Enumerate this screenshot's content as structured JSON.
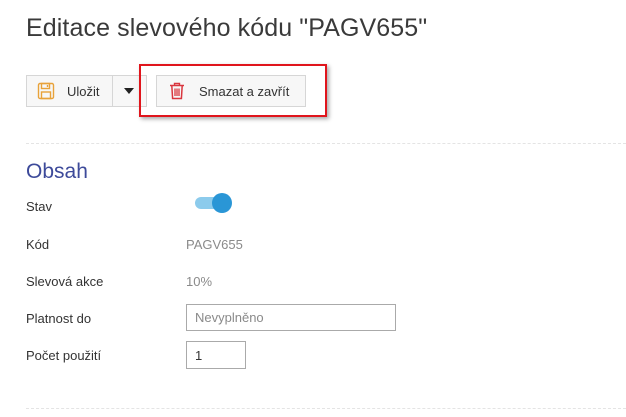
{
  "page": {
    "title": "Editace slevového kódu \"PAGV655\""
  },
  "toolbar": {
    "save_label": "Uložit",
    "save_icon": "floppy-disk-icon",
    "dropdown_icon": "caret-down-icon",
    "delete_label": "Smazat a zavřít",
    "delete_icon": "trash-icon",
    "highlight_color": "#e0151c"
  },
  "section": {
    "title": "Obsah"
  },
  "fields": {
    "stav": {
      "label": "Stav",
      "enabled": true
    },
    "kod": {
      "label": "Kód",
      "value": "PAGV655"
    },
    "akce": {
      "label": "Slevová akce",
      "value": "10%"
    },
    "platnost": {
      "label": "Platnost do",
      "value": "",
      "placeholder": "Nevyplněno"
    },
    "pocet": {
      "label": "Počet použití",
      "value": "1"
    }
  },
  "colors": {
    "section_title": "#3d4a9a",
    "toggle_on": "#2a96d6",
    "save_icon": "#e8a23a",
    "delete_icon": "#d9363e"
  }
}
